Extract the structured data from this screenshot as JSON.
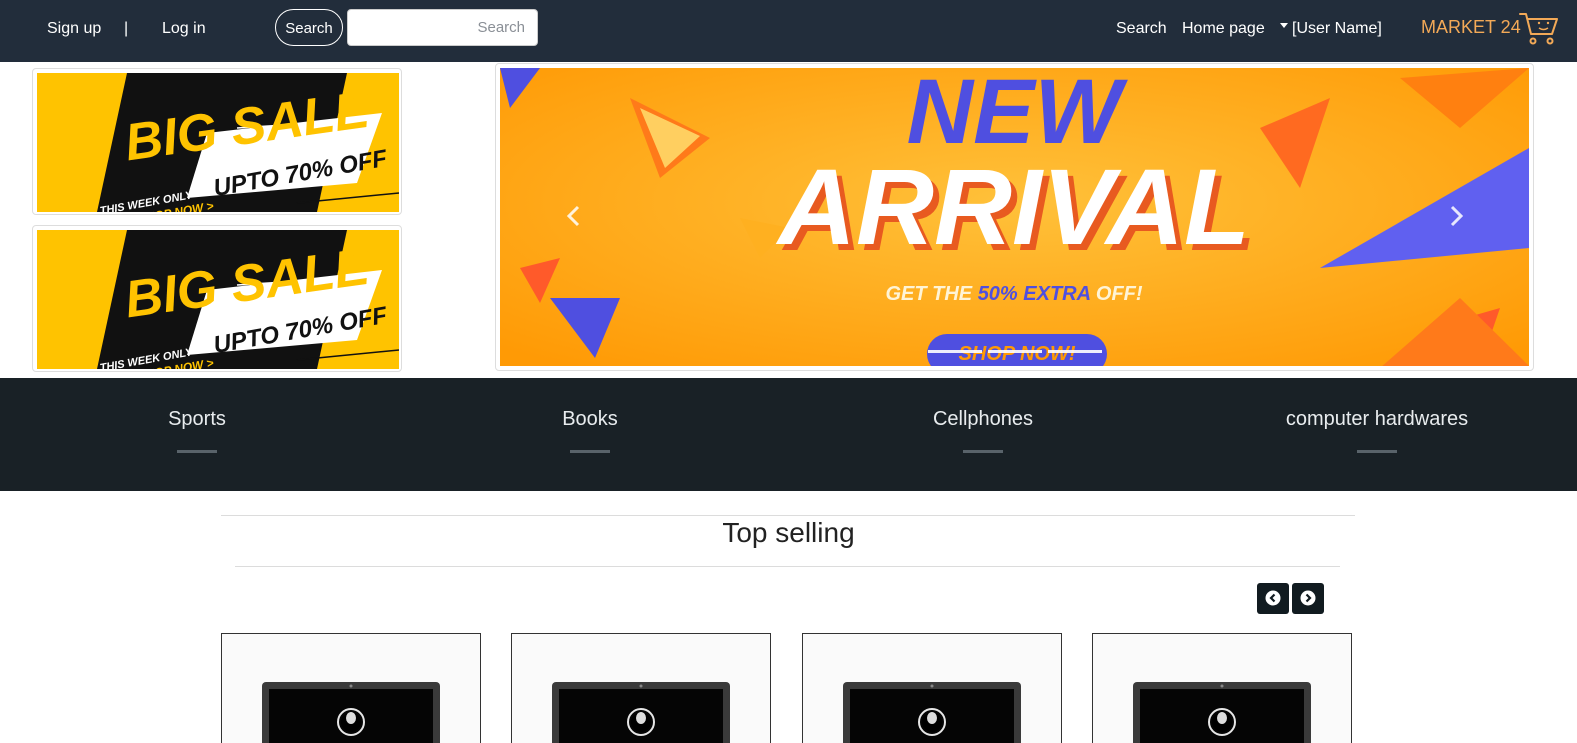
{
  "navbar": {
    "signup_label": "Sign up",
    "separator": "|",
    "login_label": "Log in",
    "search_button_label": "Search",
    "search_placeholder": "Search",
    "nav_search_label": "Search",
    "nav_home_label": "Home page",
    "user_menu_label": "[User Name]",
    "brand_label": "MARKET 24",
    "cart_icon": "shopping-cart-icon"
  },
  "banners": {
    "side": [
      {
        "headline": "BIG SALE",
        "offer": "UPTO 70% OFF",
        "tagline": "THIS WEEK ONLY",
        "cta": "SHOP NOW >"
      },
      {
        "headline": "BIG SALE",
        "offer": "UPTO 70% OFF",
        "tagline": "THIS WEEK ONLY",
        "cta": "SHOP NOW >"
      }
    ],
    "carousel": {
      "line1": "NEW",
      "line2": "ARRIVAL",
      "sub_prefix": "GET THE ",
      "sub_highlight": "50% EXTRA",
      "sub_suffix": " OFF!",
      "cta": "SHOP NOW!",
      "prev_icon": "chevron-left-icon",
      "next_icon": "chevron-right-icon",
      "slide_count": 3
    }
  },
  "categories": [
    "Sports",
    "Books",
    "Cellphones",
    "computer hardwares"
  ],
  "top_selling": {
    "title": "Top selling",
    "prev_icon": "circle-chevron-left-icon",
    "next_icon": "circle-chevron-right-icon",
    "product_count": 4
  },
  "colors": {
    "navbar_bg": "#222d3b",
    "brand": "#f3a957",
    "categories_bg": "#192126",
    "banner_yellow": "#ffc300",
    "carousel_orange": "#ffa812",
    "accent_blue": "#4f4fe0"
  }
}
